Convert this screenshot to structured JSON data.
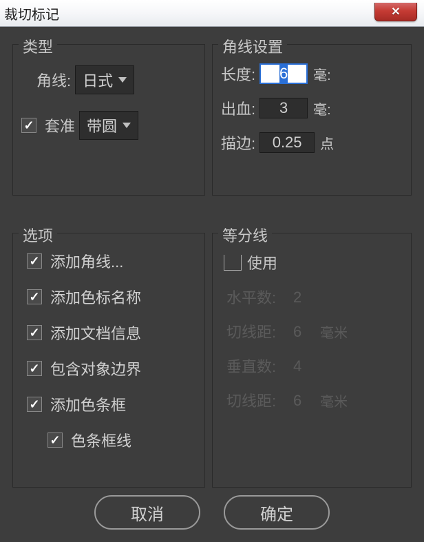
{
  "title": "裁切标记",
  "type_group": {
    "legend": "类型",
    "jiaoxian_label": "角线:",
    "jiaoxian_value": "日式",
    "taozhun_label": "套准",
    "taozhun_value": "带圆",
    "taozhun_checked": true
  },
  "corner_group": {
    "legend": "角线设置",
    "len_label": "长度:",
    "len_value": "6",
    "len_unit": "毫:",
    "bleed_label": "出血:",
    "bleed_value": "3",
    "bleed_unit": "毫:",
    "stroke_label": "描边:",
    "stroke_value": "0.25",
    "stroke_unit": "点"
  },
  "options_group": {
    "legend": "选项",
    "items": [
      {
        "label": "添加角线...",
        "checked": true,
        "indent": false
      },
      {
        "label": "添加色标名称",
        "checked": true,
        "indent": false
      },
      {
        "label": "添加文档信息",
        "checked": true,
        "indent": false
      },
      {
        "label": "包含对象边界",
        "checked": true,
        "indent": false
      },
      {
        "label": "添加色条框",
        "checked": true,
        "indent": false
      },
      {
        "label": "色条框线",
        "checked": true,
        "indent": true
      }
    ]
  },
  "divide_group": {
    "legend": "等分线",
    "use_label": "使用",
    "use_checked": false,
    "rows": [
      {
        "label": "水平数:",
        "value": "2",
        "unit": ""
      },
      {
        "label": "切线距:",
        "value": "6",
        "unit": "毫米"
      },
      {
        "label": "垂直数:",
        "value": "4",
        "unit": ""
      },
      {
        "label": "切线距:",
        "value": "6",
        "unit": "毫米"
      }
    ]
  },
  "buttons": {
    "cancel": "取消",
    "ok": "确定"
  }
}
